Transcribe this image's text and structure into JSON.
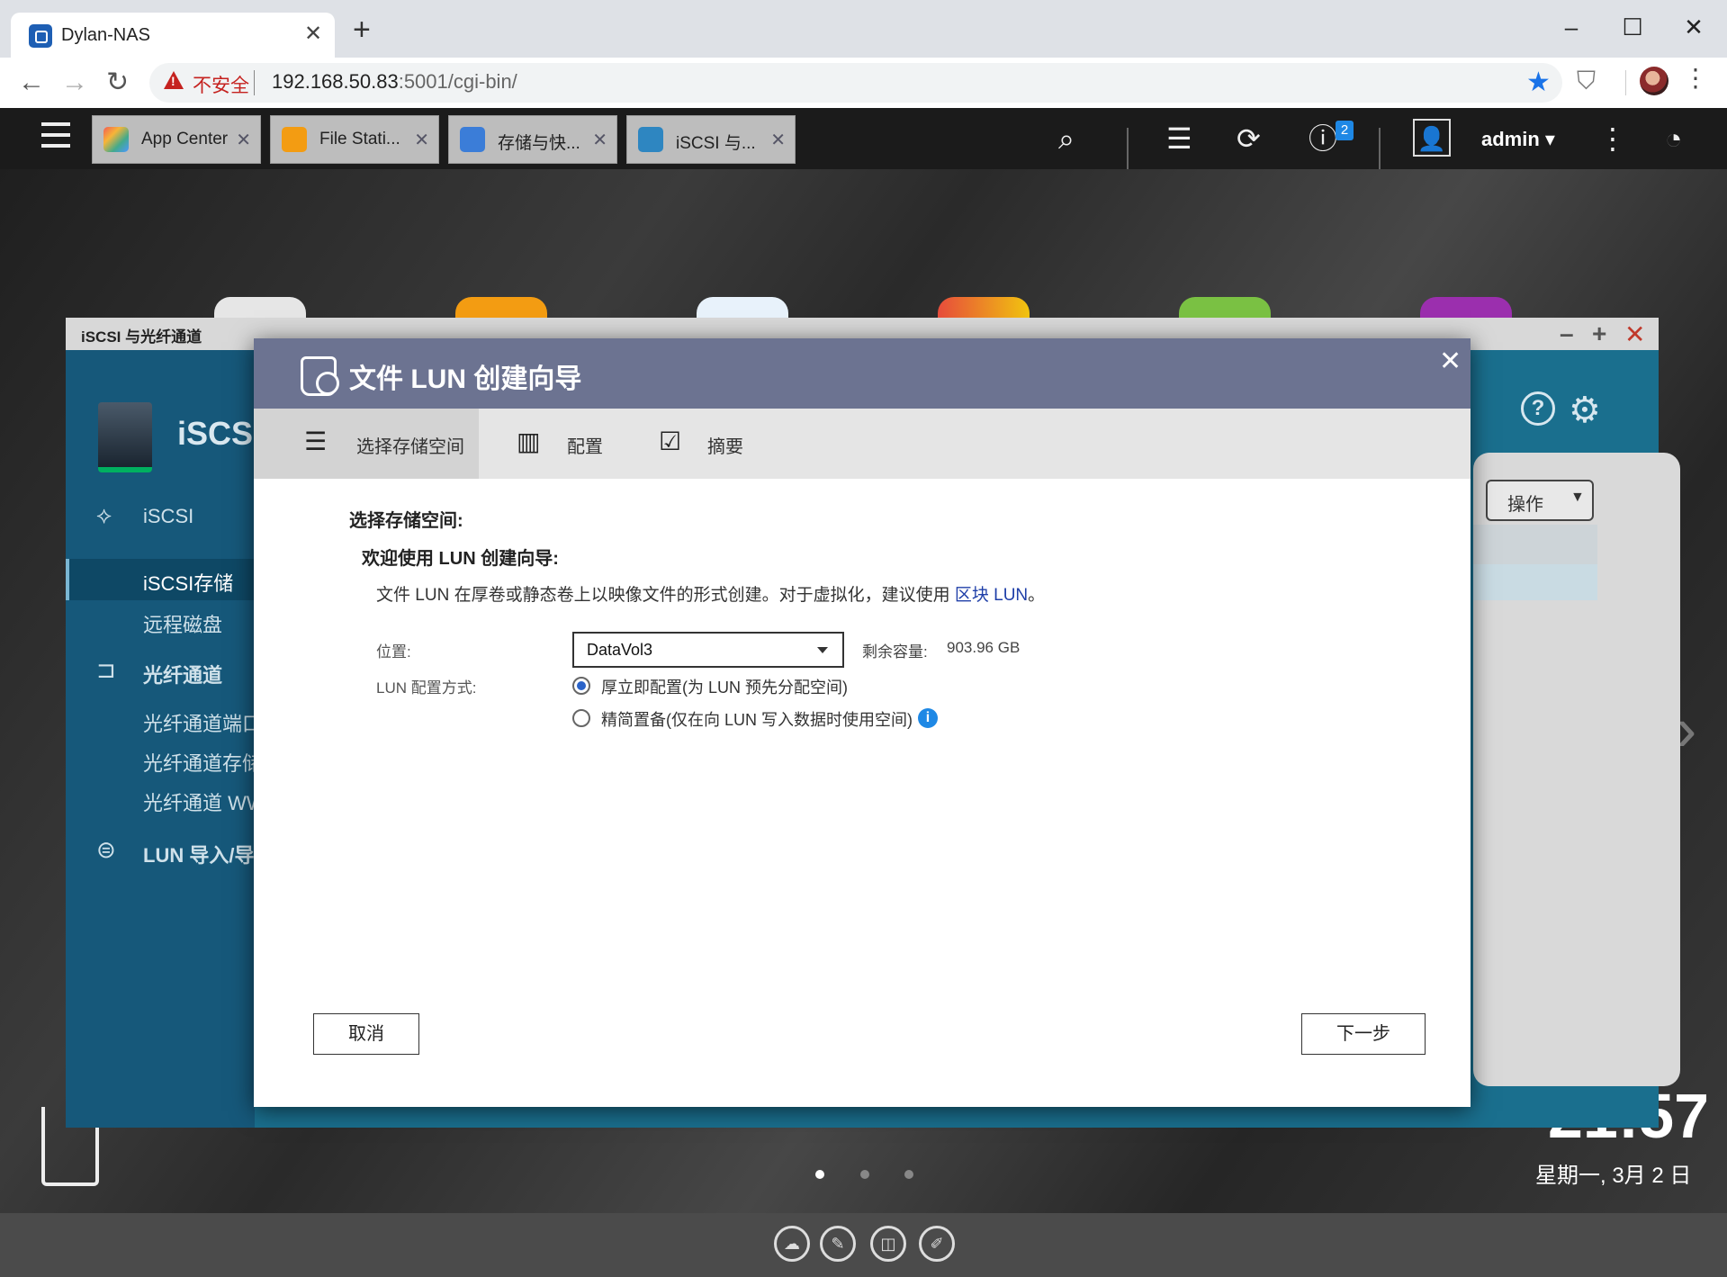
{
  "browser": {
    "tab_title": "Dylan-NAS",
    "insecure_label": "不安全",
    "url_host": "192.168.50.83",
    "url_rest": ":5001/cgi-bin/"
  },
  "qts": {
    "app_tabs": [
      {
        "label": "App Center",
        "color": "#f2c94c"
      },
      {
        "label": "File Stati...",
        "color": "#f39c12"
      },
      {
        "label": "存储与快...",
        "color": "#3b7dd8"
      },
      {
        "label": "iSCSI 与...",
        "color": "#2e86c1"
      }
    ],
    "notification_count": "2",
    "user": "admin"
  },
  "iscsi_window": {
    "title": "iSCSI 与光纤通道",
    "logo_text": "iSCSI",
    "sidebar": {
      "iscsi_header": "iSCSI",
      "iscsi_storage": "iSCSI存储",
      "remote_disk": "远程磁盘",
      "fc_header": "光纤通道",
      "fc_ports": "光纤通道端口",
      "fc_storage": "光纤通道存储",
      "fc_wwpn": "光纤通道 WW",
      "lun_header": "LUN 导入/导"
    },
    "action_button": "操作"
  },
  "wizard": {
    "title": "文件 LUN 创建向导",
    "steps": [
      "选择存储空间",
      "配置",
      "摘要"
    ],
    "section_title": "选择存储空间:",
    "welcome": "欢迎使用 LUN 创建向导:",
    "desc_text": "文件 LUN 在厚卷或静态卷上以映像文件的形式创建。对于虚拟化，建议使用",
    "desc_link": "区块 LUN",
    "desc_end": "。",
    "location_label": "位置:",
    "location_value": "DataVol3",
    "remaining_label": "剩余容量:",
    "remaining_value": "903.96 GB",
    "provision_label": "LUN 配置方式:",
    "option_thick": "厚立即配置(为 LUN 预先分配空间)",
    "option_thin": "精简置备(仅在向 LUN 写入数据时使用空间)",
    "cancel": "取消",
    "next": "下一步"
  },
  "desktop": {
    "clock": "21:57",
    "date": "星期一, 3月 2 日"
  }
}
